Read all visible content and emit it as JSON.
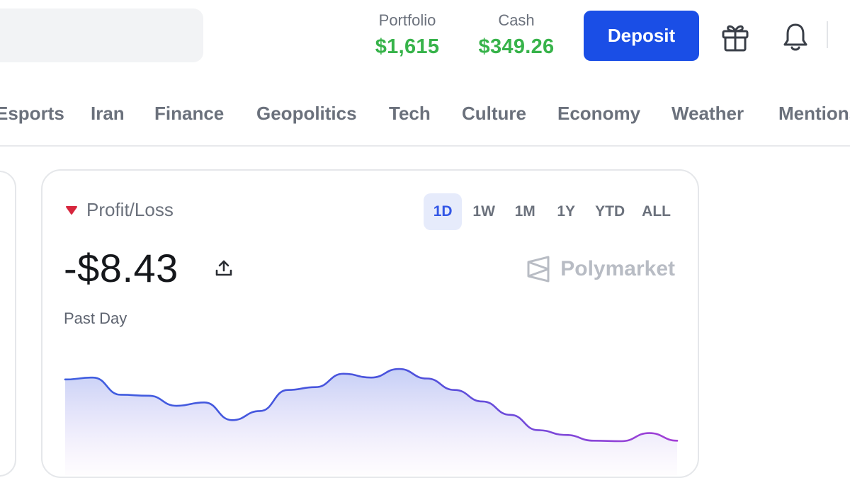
{
  "header": {
    "portfolio": {
      "label": "Portfolio",
      "value": "$1,615"
    },
    "cash": {
      "label": "Cash",
      "value": "$349.26"
    },
    "deposit_label": "Deposit",
    "icons": [
      "gift-icon",
      "bell-icon"
    ]
  },
  "categories": [
    "Esports",
    "Iran",
    "Finance",
    "Geopolitics",
    "Tech",
    "Culture",
    "Economy",
    "Weather",
    "Mentions"
  ],
  "pnl_card": {
    "title": "Profit/Loss",
    "value": "-$8.43",
    "period_label": "Past Day",
    "brand": "Polymarket",
    "ranges": [
      "1D",
      "1W",
      "1M",
      "1Y",
      "YTD",
      "ALL"
    ],
    "selected_range": "1D",
    "trend": "down"
  },
  "colors": {
    "accent": "#1a4ee6",
    "positive": "#37b34a",
    "negative": "#d7263d",
    "line_start": "#3f5ee0",
    "line_end": "#a43fd6"
  },
  "chart_data": {
    "type": "area",
    "series": [
      {
        "values": [
          -1.0,
          -0.6,
          -4.2,
          -4.4,
          -6.5,
          -5.8,
          -9.5,
          -7.6,
          -3.2,
          -2.6,
          0.2,
          -0.6,
          1.2,
          -0.8,
          -3.2,
          -5.6,
          -8.4,
          -11.6,
          -12.6,
          -13.8,
          -13.9,
          -12.2,
          -13.8
        ]
      }
    ]
  }
}
